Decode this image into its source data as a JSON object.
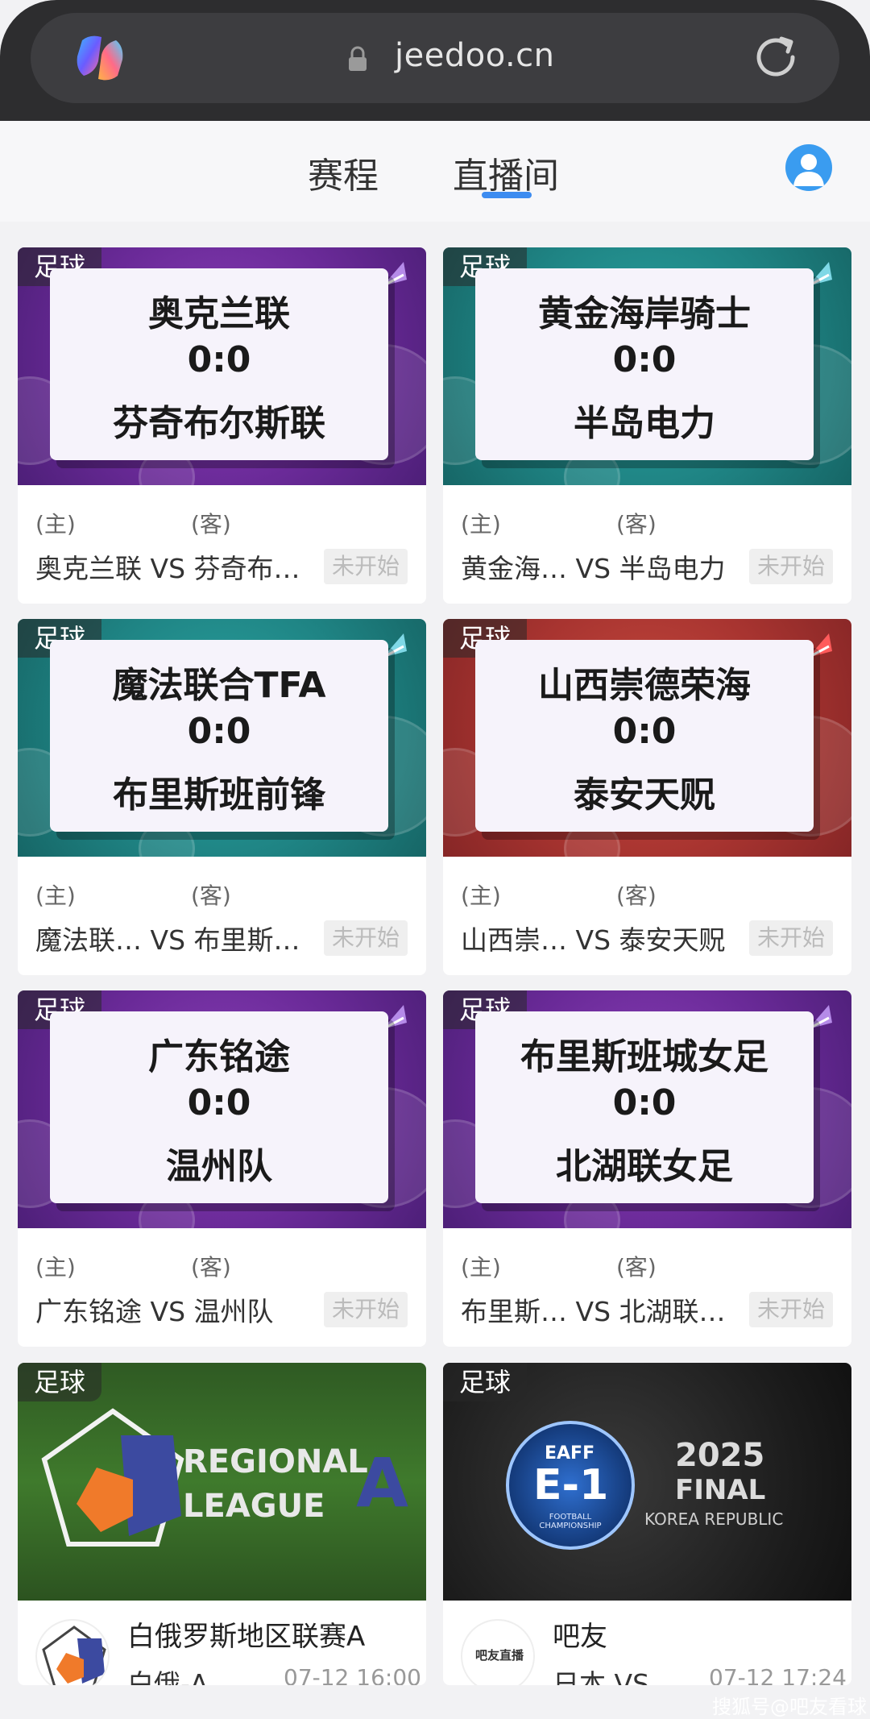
{
  "browser": {
    "url": "jeedoo.cn"
  },
  "header": {
    "tabs": [
      "赛程",
      "直播间"
    ]
  },
  "matches": [
    {
      "tag": "足球",
      "home": "奥克兰联",
      "score": "0:0",
      "away": "芬奇布尔斯联",
      "home_label": "(主)",
      "away_label": "(客)",
      "line": "奥克兰联 VS 芬奇布…",
      "status": "未开始",
      "theme": "purple"
    },
    {
      "tag": "足球",
      "home": "黄金海岸骑士",
      "score": "0:0",
      "away": "半岛电力",
      "home_label": "(主)",
      "away_label": "(客)",
      "line": "黄金海… VS 半岛电力",
      "status": "未开始",
      "theme": "teal"
    },
    {
      "tag": "足球",
      "home": "魔法联合TFA",
      "score": "0:0",
      "away": "布里斯班前锋",
      "home_label": "(主)",
      "away_label": "(客)",
      "line": "魔法联… VS 布里斯…",
      "status": "未开始",
      "theme": "teal"
    },
    {
      "tag": "足球",
      "home": "山西崇德荣海",
      "score": "0:0",
      "away": "泰安天贶",
      "home_label": "(主)",
      "away_label": "(客)",
      "line": "山西崇… VS 泰安天贶",
      "status": "未开始",
      "theme": "red"
    },
    {
      "tag": "足球",
      "home": "广东铭途",
      "score": "0:0",
      "away": "温州队",
      "home_label": "(主)",
      "away_label": "(客)",
      "line": "广东铭途 VS 温州队",
      "status": "未开始",
      "theme": "purple"
    },
    {
      "tag": "足球",
      "home": "布里斯班城女足",
      "score": "0:0",
      "away": "北湖联女足",
      "home_label": "(主)",
      "away_label": "(客)",
      "line": "布里斯… VS 北湖联…",
      "status": "未开始",
      "theme": "purple"
    }
  ],
  "streams": [
    {
      "tag": "足球",
      "banner_text_1": "REGIONAL",
      "banner_text_2": "LEAGUE",
      "banner_text_3": "A",
      "title": "白俄罗斯地区联赛A",
      "subtitle": "白俄-A",
      "time": "07-12 16:00"
    },
    {
      "tag": "足球",
      "banner_text_1": "2025",
      "banner_text_2": "FINAL",
      "banner_text_3": "KOREA REPUBLIC",
      "badge_top": "EAFF",
      "badge_main": "E-1",
      "badge_sub": "FOOTBALL CHAMPIONSHIP",
      "avatar_text": "吧友直播",
      "title": "吧友",
      "subtitle": "日本 VS …",
      "time": "07-12 17:24"
    }
  ],
  "watermark": "搜狐号@吧友看球",
  "colors": {
    "accent": "#3d8cf0",
    "purple": "#6a2a98",
    "teal": "#1f8484",
    "red": "#a83430"
  }
}
